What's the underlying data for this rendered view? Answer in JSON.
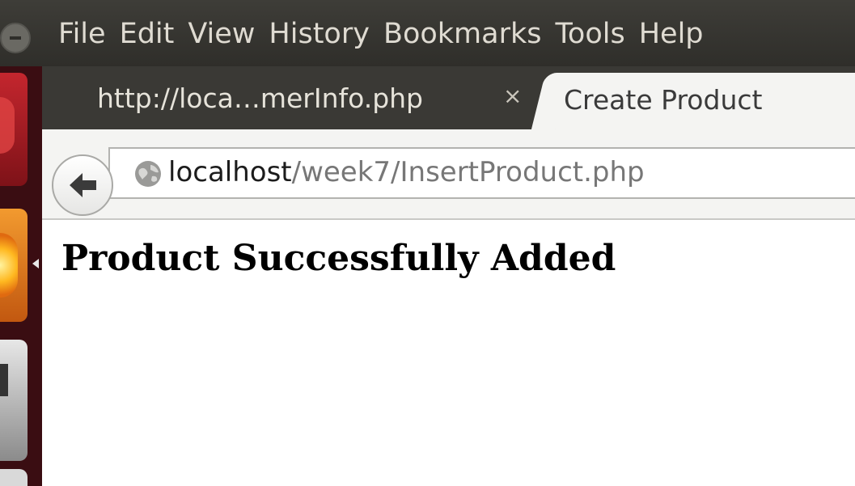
{
  "menubar": {
    "items": [
      "File",
      "Edit",
      "View",
      "History",
      "Bookmarks",
      "Tools",
      "Help"
    ]
  },
  "tabs": [
    {
      "label": "http://loca…merInfo.php",
      "close": "×",
      "active": false
    },
    {
      "label": "Create Product",
      "active": true
    }
  ],
  "navbar": {
    "url_host": "localhost",
    "url_path": "/week7/InsertProduct.php"
  },
  "page": {
    "heading": "Product Successfully Added"
  },
  "icons": {
    "back": "back-arrow-icon",
    "site": "globe-icon",
    "window_menu": "window-menu-icon"
  }
}
